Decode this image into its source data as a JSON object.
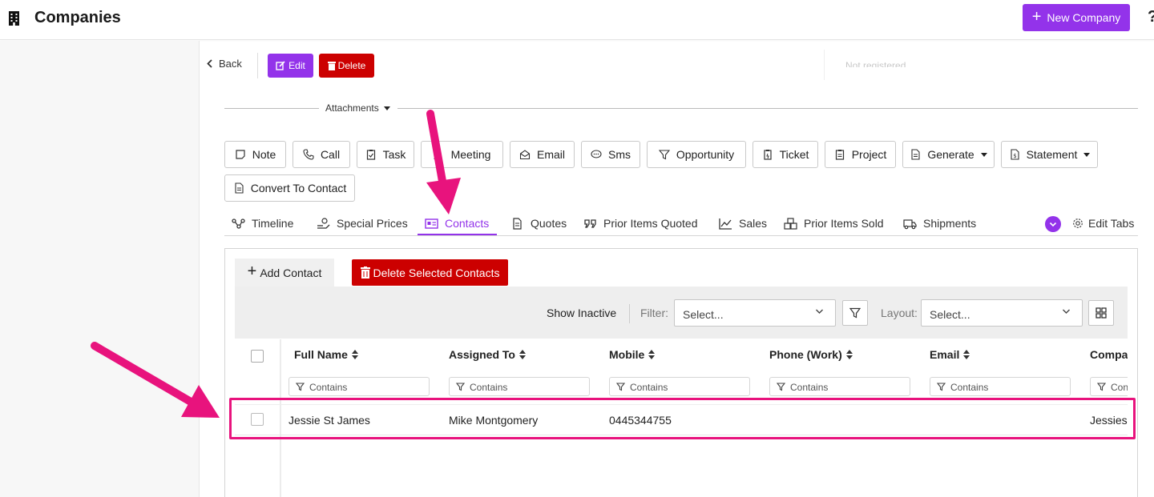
{
  "header": {
    "title": "Companies",
    "new_button": "New Company",
    "help": "?"
  },
  "record_actions": {
    "back": "Back",
    "edit": "Edit",
    "delete": "Delete",
    "partial_text": "Not registered"
  },
  "attachments": {
    "label": "Attachments",
    "buttons": [
      "Note",
      "Call",
      "Task",
      "Meeting",
      "Email",
      "Sms",
      "Opportunity",
      "Ticket",
      "Project",
      "Generate",
      "Statement",
      "Convert To Contact"
    ]
  },
  "tabs": {
    "items": [
      "Timeline",
      "Special Prices",
      "Contacts",
      "Quotes",
      "Prior Items Quoted",
      "Sales",
      "Prior Items Sold",
      "Shipments"
    ],
    "active": "Contacts",
    "edit_tabs": "Edit Tabs"
  },
  "contacts": {
    "add_button": "Add Contact",
    "delete_button": "Delete Selected Contacts",
    "show_inactive": "Show Inactive",
    "filter_label": "Filter:",
    "filter_placeholder": "Select...",
    "layout_label": "Layout:",
    "layout_placeholder": "Select...",
    "columns": [
      "Full Name",
      "Assigned To",
      "Mobile",
      "Phone (Work)",
      "Email",
      "Compar"
    ],
    "filter_hint": "Contains",
    "filter_hint_truncated": "Con",
    "rows": [
      {
        "full_name": "Jessie St James",
        "assigned_to": "Mike Montgomery",
        "mobile": "0445344755",
        "phone_work": "",
        "email": "",
        "company": "Jessies"
      }
    ]
  },
  "colors": {
    "accent": "#9333ea",
    "danger": "#cc0000",
    "annotation": "#e8137d"
  }
}
